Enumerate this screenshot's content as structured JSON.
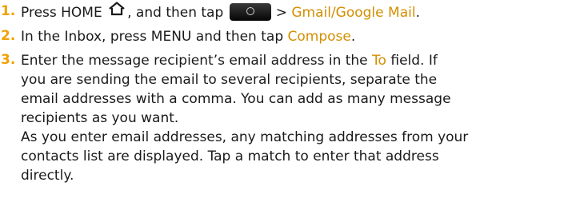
{
  "steps": [
    {
      "number": "1.",
      "parts": {
        "a": "Press HOME",
        "b": ", and then tap",
        "c": "> ",
        "d": "Gmail/Google Mail",
        "e": "."
      }
    },
    {
      "number": "2.",
      "parts": {
        "a": "In the Inbox, press MENU and then tap ",
        "b": "Compose",
        "c": "."
      }
    },
    {
      "number": "3.",
      "lines": {
        "l1a": "Enter the message recipient’s email address in the ",
        "l1b": "To",
        "l1c": " field. If",
        "l2": "you are sending the email to several recipients, separate the",
        "l3": "email addresses with a comma. You can add as many message",
        "l4": "recipients as you want.",
        "l5": "As you enter email addresses, any matching addresses from your",
        "l6": "contacts list are displayed. Tap a match to enter that address",
        "l7": "directly."
      }
    }
  ],
  "icons": {
    "home": "home-icon",
    "all_apps": "all-apps-button-icon"
  },
  "colors": {
    "number": "#f2a100",
    "accent_text": "#d38f00",
    "text": "#1a1a1a"
  }
}
